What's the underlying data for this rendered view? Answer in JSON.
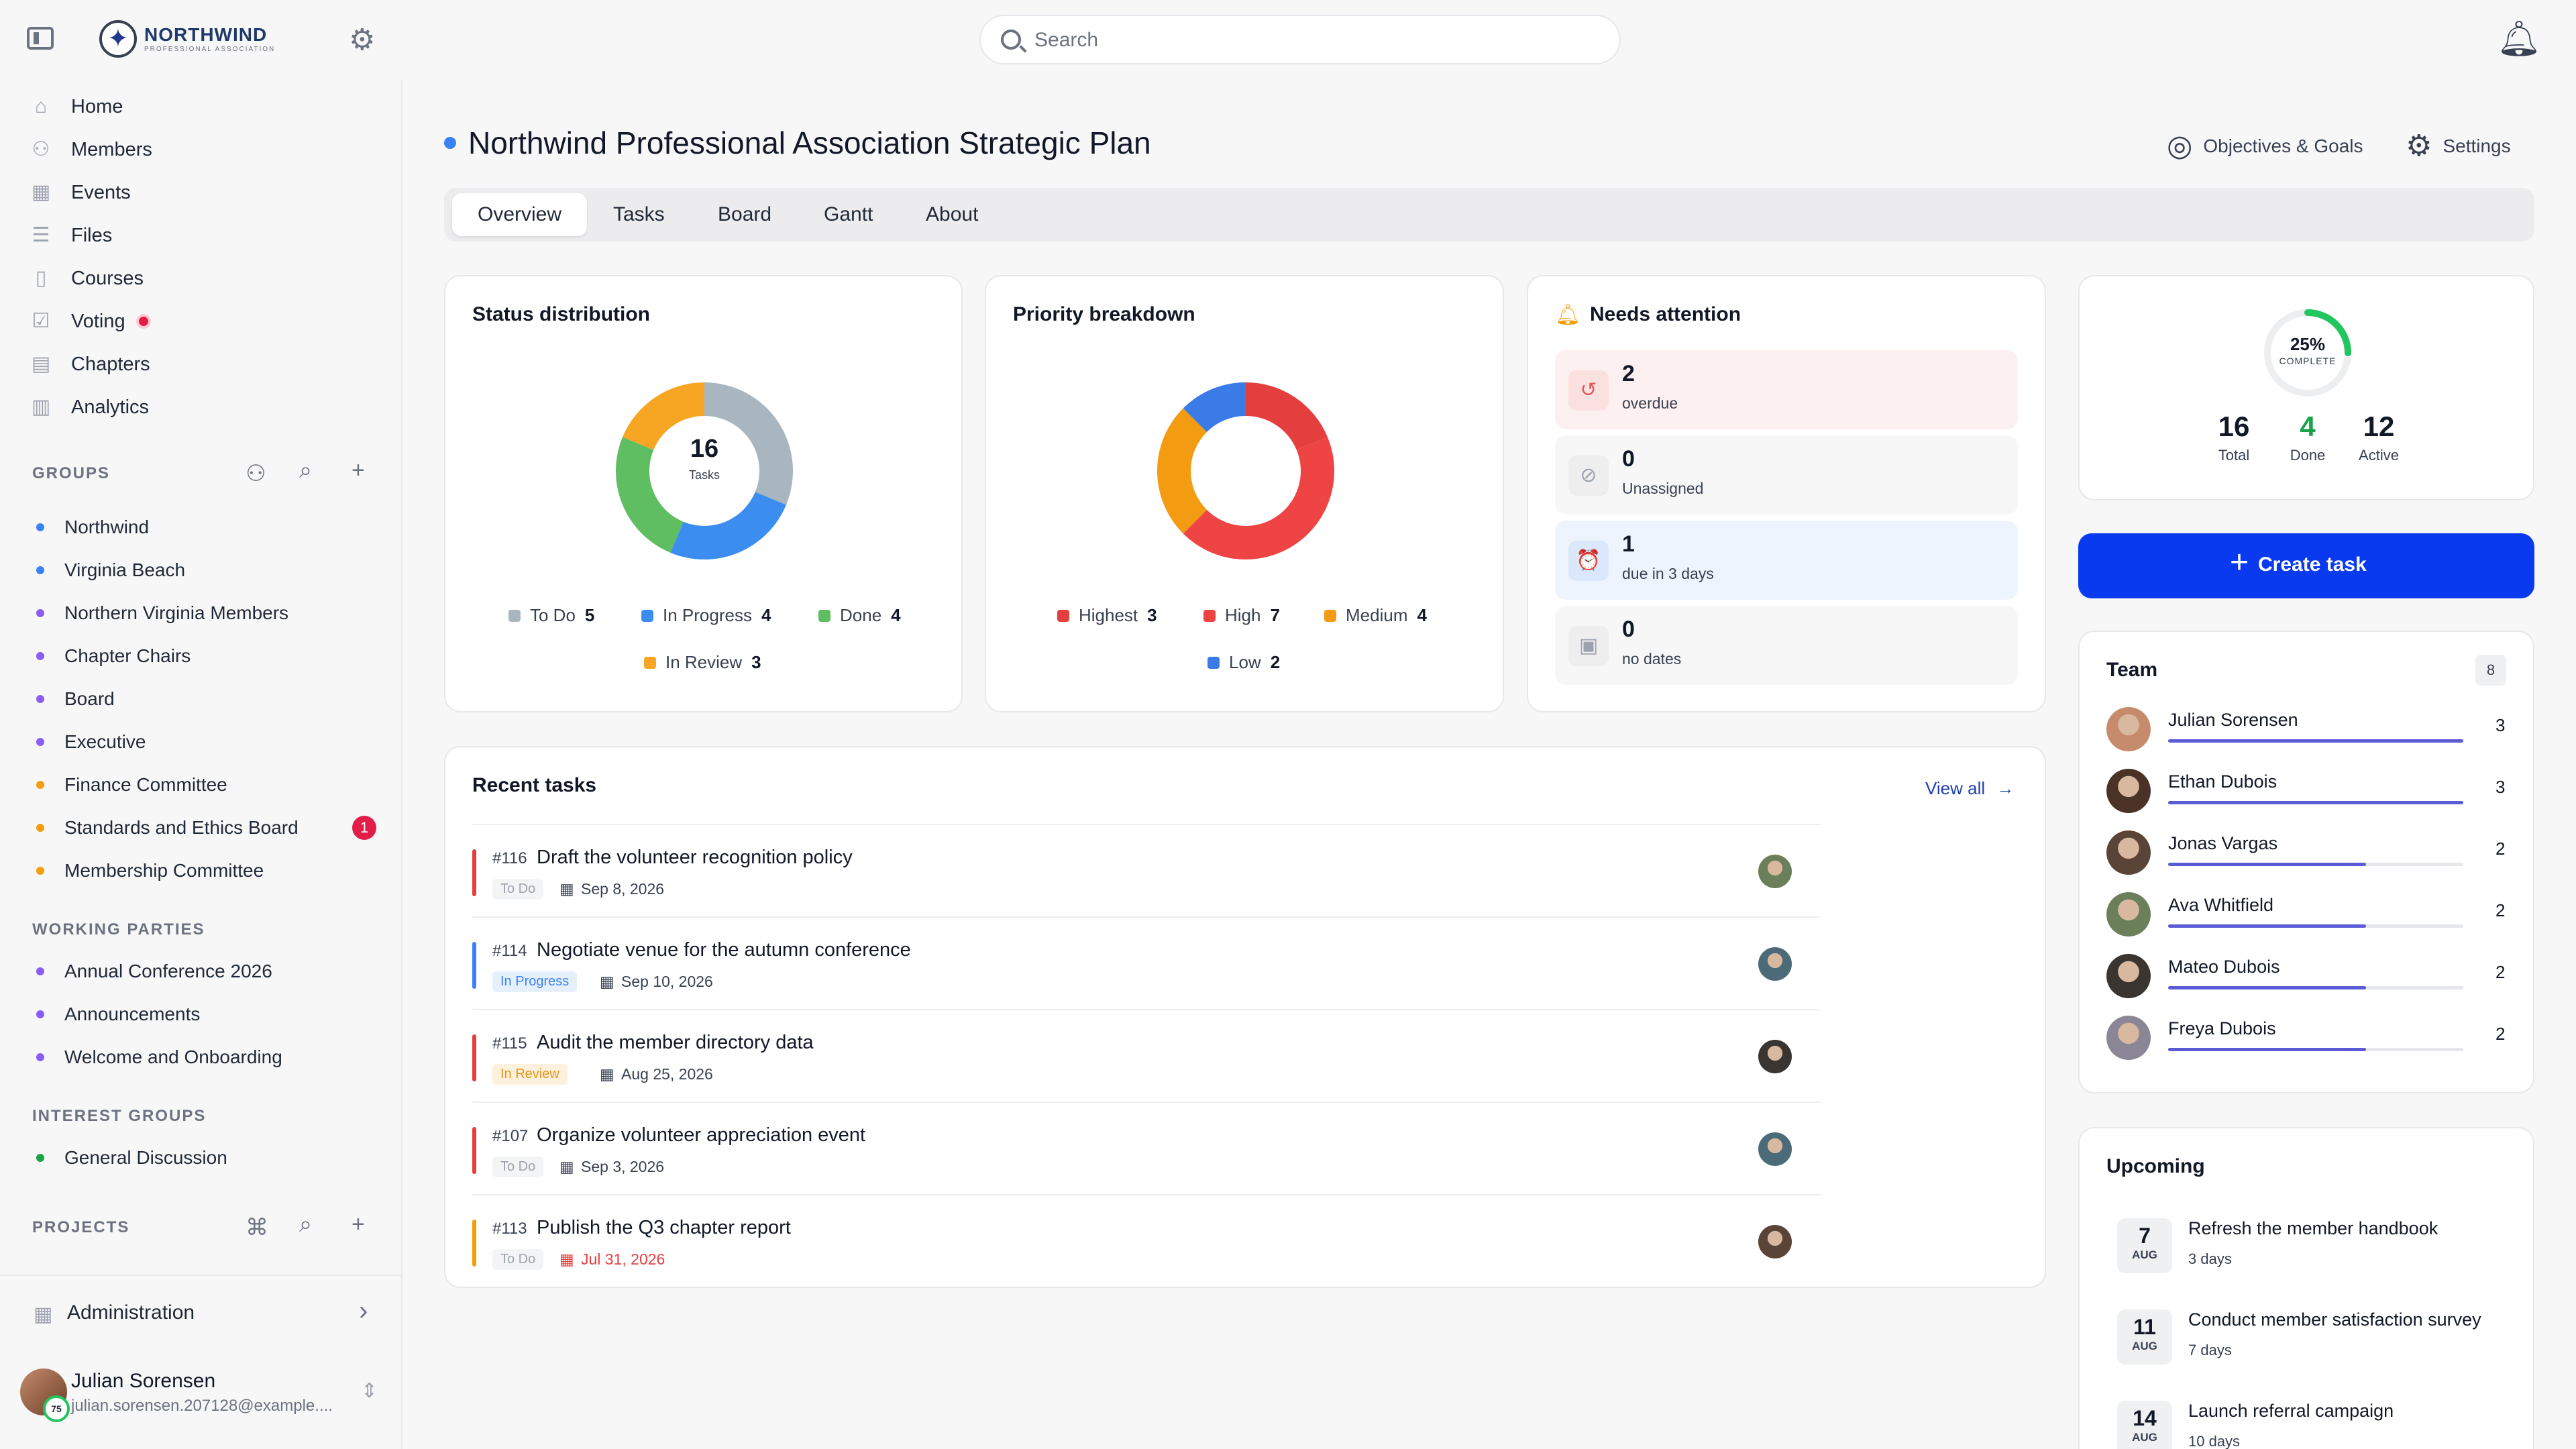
{
  "brand": {
    "name": "NORTHWIND",
    "sub": "PROFESSIONAL ASSOCIATION"
  },
  "search": {
    "placeholder": "Search"
  },
  "nav": [
    {
      "label": "Home",
      "icon": "home-icon",
      "glyph": "⌂"
    },
    {
      "label": "Members",
      "icon": "members-icon",
      "glyph": "⚇"
    },
    {
      "label": "Events",
      "icon": "calendar-icon",
      "glyph": "▦"
    },
    {
      "label": "Files",
      "icon": "database-icon",
      "glyph": "☰"
    },
    {
      "label": "Courses",
      "icon": "book-icon",
      "glyph": "▯"
    },
    {
      "label": "Voting",
      "icon": "vote-icon",
      "glyph": "☑"
    },
    {
      "label": "Chapters",
      "icon": "chapters-icon",
      "glyph": "▤"
    },
    {
      "label": "Analytics",
      "icon": "analytics-icon",
      "glyph": "▥"
    }
  ],
  "sections": {
    "groups": "GROUPS",
    "working_parties": "WORKING PARTIES",
    "interest_groups": "INTEREST GROUPS",
    "projects": "PROJECTS"
  },
  "groups": [
    {
      "label": "Northwind",
      "color": "#3b82f6"
    },
    {
      "label": "Virginia Beach",
      "color": "#3b82f6"
    },
    {
      "label": "Northern Virginia Members",
      "color": "#8b5cf6"
    },
    {
      "label": "Chapter Chairs",
      "color": "#8b5cf6"
    },
    {
      "label": "Board",
      "color": "#8b5cf6"
    },
    {
      "label": "Executive",
      "color": "#8b5cf6"
    },
    {
      "label": "Finance Committee",
      "color": "#f59e0b"
    },
    {
      "label": "Standards and Ethics Board",
      "color": "#f59e0b",
      "badge": "1"
    },
    {
      "label": "Membership Committee",
      "color": "#f59e0b"
    }
  ],
  "working_parties": [
    {
      "label": "Annual Conference 2026",
      "color": "#8b5cf6"
    },
    {
      "label": "Announcements",
      "color": "#8b5cf6"
    },
    {
      "label": "Welcome and Onboarding",
      "color": "#8b5cf6"
    }
  ],
  "interest_groups": [
    {
      "label": "General Discussion",
      "color": "#16a34a"
    }
  ],
  "admin": {
    "label": "Administration"
  },
  "user": {
    "name": "Julian Sorensen",
    "email": "julian.sorensen.207128@example....",
    "level": "75"
  },
  "page": {
    "title": "Northwind Professional Association Strategic Plan",
    "objectives_label": "Objectives & Goals",
    "settings_label": "Settings",
    "tabs": [
      "Overview",
      "Tasks",
      "Board",
      "Gantt",
      "About"
    ]
  },
  "status": {
    "title": "Status distribution",
    "center_value": "16",
    "center_label": "Tasks",
    "items": [
      {
        "label": "To Do",
        "value": 5,
        "color": "#aab6bf"
      },
      {
        "label": "In Progress",
        "value": 4,
        "color": "#3b8ef0"
      },
      {
        "label": "Done",
        "value": 4,
        "color": "#5fbd62"
      },
      {
        "label": "In Review",
        "value": 3,
        "color": "#f6a623"
      }
    ]
  },
  "priority": {
    "title": "Priority breakdown",
    "items": [
      {
        "label": "Highest",
        "value": 3,
        "color": "#e53e3e"
      },
      {
        "label": "High",
        "value": 7,
        "color": "#ee4444"
      },
      {
        "label": "Medium",
        "value": 4,
        "color": "#f39c12"
      },
      {
        "label": "Low",
        "value": 2,
        "color": "#3b7be8"
      }
    ]
  },
  "attention": {
    "title": "Needs attention",
    "rows": [
      {
        "value": "2",
        "label": "overdue",
        "bg": "#fdf0f0",
        "icon_bg": "#fbe0e0",
        "icon_color": "#e05a5a",
        "glyph": "↺"
      },
      {
        "value": "0",
        "label": "Unassigned",
        "bg": "#f7f7f8",
        "icon_bg": "#eeeeef",
        "icon_color": "#9ca3af",
        "glyph": "⊘"
      },
      {
        "value": "1",
        "label": "due in 3 days",
        "bg": "#eef4fd",
        "icon_bg": "#dbe8fb",
        "icon_color": "#5b8def",
        "glyph": "⏰"
      },
      {
        "value": "0",
        "label": "no dates",
        "bg": "#f7f7f8",
        "icon_bg": "#eeeeef",
        "icon_color": "#9ca3af",
        "glyph": "▣"
      }
    ]
  },
  "summary": {
    "percent": "25%",
    "percent_label": "COMPLETE",
    "progress": 0.25,
    "stats": [
      {
        "value": "16",
        "label": "Total",
        "color": "#111827"
      },
      {
        "value": "4",
        "label": "Done",
        "color": "#16a34a"
      },
      {
        "value": "12",
        "label": "Active",
        "color": "#111827"
      }
    ]
  },
  "create_task": {
    "label": "Create task"
  },
  "team": {
    "title": "Team",
    "count": "8",
    "members": [
      {
        "name": "Julian Sorensen",
        "count": "3",
        "progress": 1.0,
        "color": "#c58b6b"
      },
      {
        "name": "Ethan Dubois",
        "count": "3",
        "progress": 1.0,
        "color": "#4a3326"
      },
      {
        "name": "Jonas Vargas",
        "count": "2",
        "progress": 0.67,
        "color": "#5a4438"
      },
      {
        "name": "Ava Whitfield",
        "count": "2",
        "progress": 0.67,
        "color": "#6a7f5a"
      },
      {
        "name": "Mateo Dubois",
        "count": "2",
        "progress": 0.67,
        "color": "#3a3530"
      },
      {
        "name": "Freya Dubois",
        "count": "2",
        "progress": 0.67,
        "color": "#8b8696"
      }
    ]
  },
  "recent": {
    "title": "Recent tasks",
    "view_all": "View all",
    "tasks": [
      {
        "id": "#116",
        "title": "Draft the volunteer recognition policy",
        "status": "To Do",
        "date": "Sep 8, 2026",
        "bar": "#e53e3e",
        "status_bg": "#f3f4f6",
        "status_color": "#9ca3af",
        "date_color": "#374151",
        "avatar": "#6a7f5a"
      },
      {
        "id": "#114",
        "title": "Negotiate venue for the autumn conference",
        "status": "In Progress",
        "date": "Sep 10, 2026",
        "bar": "#3b82f6",
        "status_bg": "#e6f0fd",
        "status_color": "#3b82f6",
        "date_color": "#374151",
        "avatar": "#4b6b78"
      },
      {
        "id": "#115",
        "title": "Audit the member directory data",
        "status": "In Review",
        "date": "Aug 25, 2026",
        "bar": "#e53e3e",
        "status_bg": "#fdf1dd",
        "status_color": "#e59416",
        "date_color": "#374151",
        "avatar": "#3a3530"
      },
      {
        "id": "#107",
        "title": "Organize volunteer appreciation event",
        "status": "To Do",
        "date": "Sep 3, 2026",
        "bar": "#e53e3e",
        "status_bg": "#f3f4f6",
        "status_color": "#9ca3af",
        "date_color": "#374151",
        "avatar": "#4b6b78"
      },
      {
        "id": "#113",
        "title": "Publish the Q3 chapter report",
        "status": "To Do",
        "date": "Jul 31, 2026",
        "bar": "#f59e0b",
        "status_bg": "#f3f4f6",
        "status_color": "#9ca3af",
        "date_color": "#e53e3e",
        "avatar": "#5a4438"
      }
    ]
  },
  "upcoming": {
    "title": "Upcoming",
    "items": [
      {
        "day": "7",
        "month": "AUG",
        "title": "Refresh the member handbook",
        "sub": "3 days"
      },
      {
        "day": "11",
        "month": "AUG",
        "title": "Conduct member satisfaction survey",
        "sub": "7 days"
      },
      {
        "day": "14",
        "month": "AUG",
        "title": "Launch referral campaign",
        "sub": "10 days"
      }
    ]
  }
}
